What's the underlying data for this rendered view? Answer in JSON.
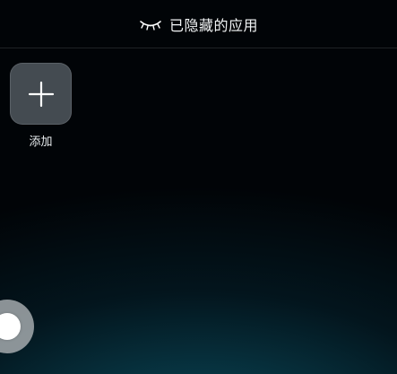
{
  "header": {
    "title": "已隐藏的应用",
    "icon": "closed-eye-icon"
  },
  "apps": [
    {
      "label": "添加",
      "icon": "plus-icon"
    }
  ],
  "floating_button": {
    "icon": "assistive-touch-icon"
  },
  "colors": {
    "background_top": "#010407",
    "background_bottom": "#0d4a57",
    "tile": "#50585e",
    "text": "#ffffff"
  }
}
